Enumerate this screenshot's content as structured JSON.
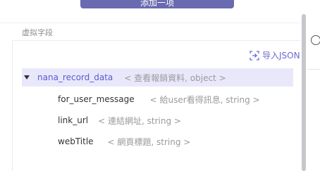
{
  "top_button": {
    "label": "添加一项"
  },
  "section": {
    "title": "虚拟字段"
  },
  "import": {
    "label": "导入JSON",
    "icon": "import-json-icon"
  },
  "fields": [
    {
      "name": "nana_record_data",
      "meta": "< 查看報銷資料, object >",
      "expanded": true,
      "selected": true,
      "level": 0
    },
    {
      "name": "for_user_message",
      "meta": "< 給user看得訊息, string >",
      "level": 1
    },
    {
      "name": "link_url",
      "meta": "< 連結網址, string >",
      "level": 1
    },
    {
      "name": "webTitle",
      "meta": "< 網頁標題, string >",
      "level": 1
    }
  ],
  "colors": {
    "accent": "#6a6ad4",
    "selected_bg": "#e9e8fb",
    "button_bg": "#6a6ab0",
    "meta_text": "#9a9a9a"
  }
}
